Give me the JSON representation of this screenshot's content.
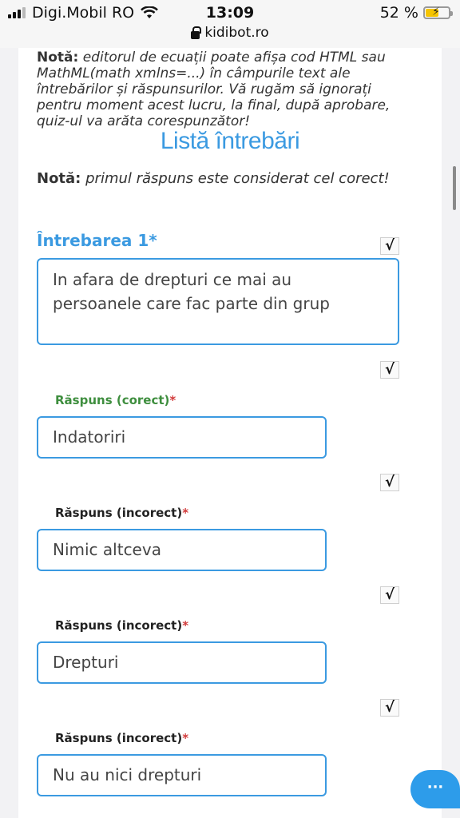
{
  "status_bar": {
    "carrier": "Digi.Mobil RO",
    "time": "13:09",
    "battery_percent": "52 %",
    "url": "kidibot.ro"
  },
  "notes": {
    "editor_label": "Notă:",
    "editor_text": "editorul de ecuații poate afișa cod HTML sau MathML(math xmlns=...) în câmpurile text ale întrebărilor și răspunsurilor. Vă rugăm să ignorați pentru moment acest lucru, la final, după aprobare, quiz-ul va arăta corespunzător!",
    "correct_label": "Notă:",
    "correct_text": "primul răspuns este considerat cel corect!"
  },
  "list_title": "Listă întrebări",
  "question": {
    "label": "Întrebarea 1*",
    "text": "In afara de drepturi ce mai au persoanele care fac parte din grup"
  },
  "answers": [
    {
      "label": "Răspuns (corect)",
      "required": "*",
      "value": "Indatoriri"
    },
    {
      "label": "Răspuns (incorect)",
      "required": "*",
      "value": "Nimic altceva"
    },
    {
      "label": "Răspuns (incorect)",
      "required": "*",
      "value": "Drepturi"
    },
    {
      "label": "Răspuns (incorect)",
      "required": "*",
      "value": "Nu au nici drepturi"
    }
  ],
  "icons": {
    "check": "√",
    "chat": "···"
  },
  "colors": {
    "accent": "#3b9ae1",
    "correct": "#3e8e3e",
    "required": "#d23b3b"
  }
}
